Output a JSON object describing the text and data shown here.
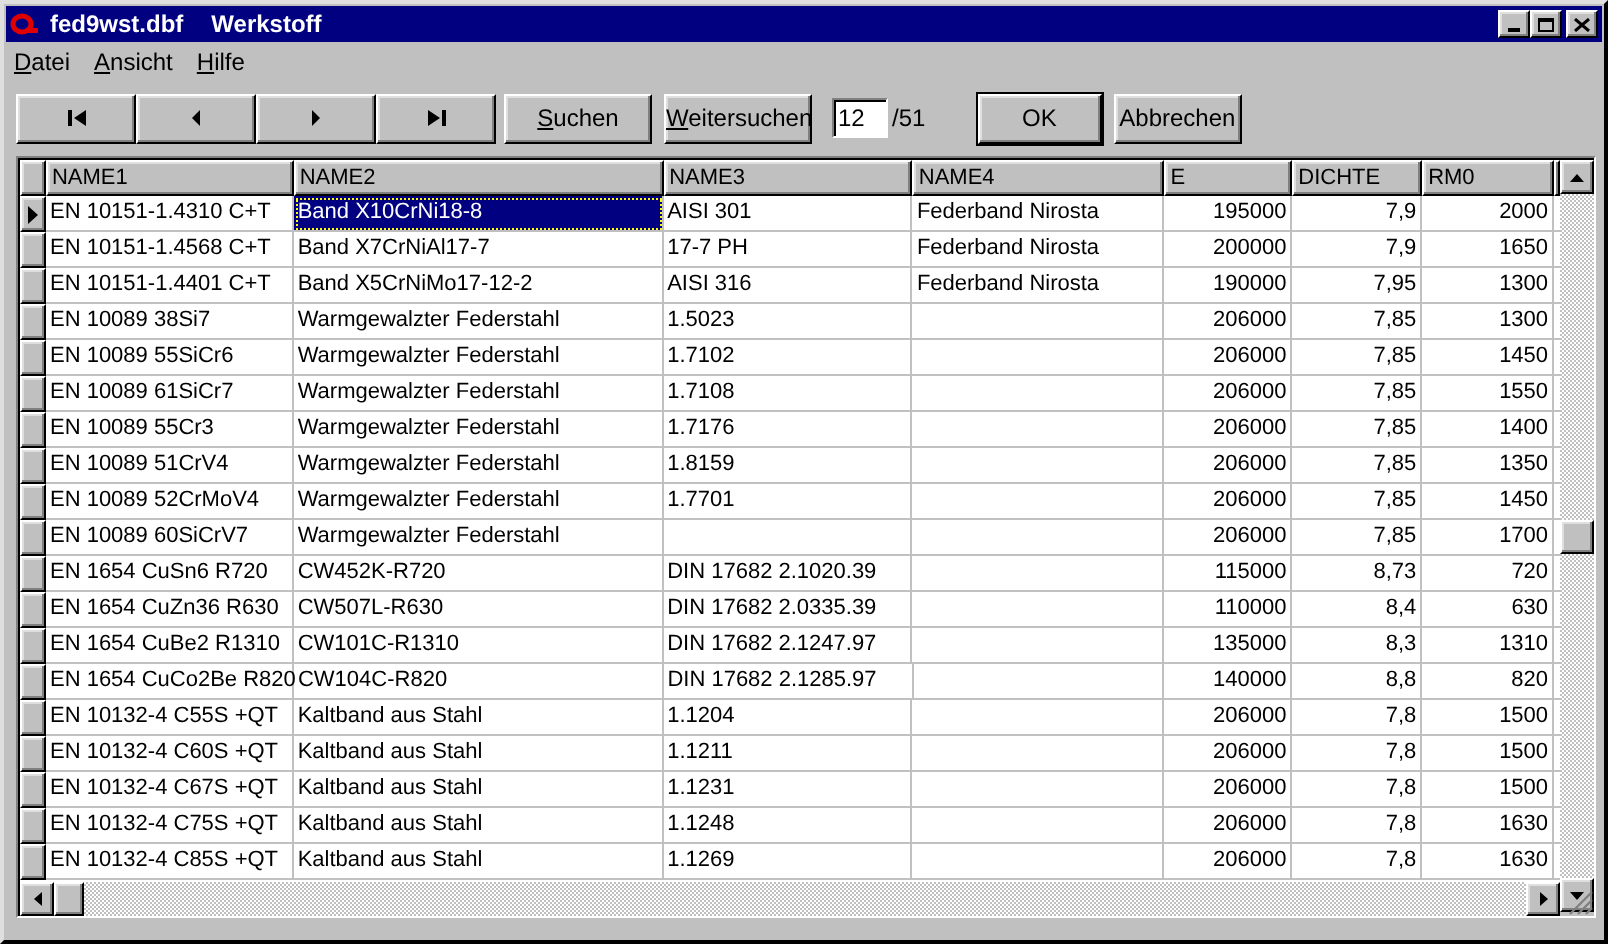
{
  "window": {
    "filename": "fed9wst.dbf",
    "title": "Werkstoff"
  },
  "menu": [
    {
      "label": "Datei",
      "mnemonic": true
    },
    {
      "label": "Ansicht",
      "mnemonic": true
    },
    {
      "label": "Hilfe",
      "mnemonic": true
    }
  ],
  "toolbar": {
    "nav": [
      {
        "kind": "first"
      },
      {
        "kind": "prev"
      },
      {
        "kind": "next"
      },
      {
        "kind": "last"
      }
    ],
    "search_buttons": [
      {
        "label": "Suchen",
        "mnemonic": true
      },
      {
        "label": "Weitersuchen",
        "mnemonic": true
      }
    ],
    "record": {
      "value": "12",
      "total": "/51"
    },
    "ok": {
      "label": "OK",
      "default": true
    },
    "cancel": {
      "label": "Abbrechen",
      "default": false
    }
  },
  "table": {
    "columns": [
      {
        "label": "NAME1",
        "kind": "text"
      },
      {
        "label": "NAME2",
        "kind": "text"
      },
      {
        "label": "NAME3",
        "kind": "text"
      },
      {
        "label": "NAME4",
        "kind": "text"
      },
      {
        "label": "E",
        "kind": "number"
      },
      {
        "label": "DICHTE",
        "kind": "number"
      },
      {
        "label": "RM0",
        "kind": "number"
      }
    ],
    "rows": [
      {
        "selected": true,
        "cells": [
          {
            "text": "EN 10151-1.4310 C+T",
            "selected": false
          },
          {
            "text": "Band X10CrNi18-8",
            "selected": true
          },
          {
            "text": "AISI 301",
            "selected": false
          },
          {
            "text": "Federband Nirosta",
            "selected": false
          },
          {
            "text": "195000",
            "selected": false
          },
          {
            "text": "7,9",
            "selected": false
          },
          {
            "text": "2000",
            "selected": false
          }
        ]
      },
      {
        "selected": false,
        "cells": [
          {
            "text": "EN 10151-1.4568 C+T",
            "selected": false
          },
          {
            "text": "Band X7CrNiAl17-7",
            "selected": false
          },
          {
            "text": "17-7 PH",
            "selected": false
          },
          {
            "text": "Federband Nirosta",
            "selected": false
          },
          {
            "text": "200000",
            "selected": false
          },
          {
            "text": "7,9",
            "selected": false
          },
          {
            "text": "1650",
            "selected": false
          }
        ]
      },
      {
        "selected": false,
        "cells": [
          {
            "text": "EN 10151-1.4401 C+T",
            "selected": false
          },
          {
            "text": "Band X5CrNiMo17-12-2",
            "selected": false
          },
          {
            "text": "AISI 316",
            "selected": false
          },
          {
            "text": "Federband Nirosta",
            "selected": false
          },
          {
            "text": "190000",
            "selected": false
          },
          {
            "text": "7,95",
            "selected": false
          },
          {
            "text": "1300",
            "selected": false
          }
        ]
      },
      {
        "selected": false,
        "cells": [
          {
            "text": "EN 10089 38Si7",
            "selected": false
          },
          {
            "text": "Warmgewalzter Federstahl",
            "selected": false
          },
          {
            "text": "1.5023",
            "selected": false
          },
          {
            "selected": false
          },
          {
            "text": "206000",
            "selected": false
          },
          {
            "text": "7,85",
            "selected": false
          },
          {
            "text": "1300",
            "selected": false
          }
        ]
      },
      {
        "selected": false,
        "cells": [
          {
            "text": "EN 10089 55SiCr6",
            "selected": false
          },
          {
            "text": "Warmgewalzter Federstahl",
            "selected": false
          },
          {
            "text": "1.7102",
            "selected": false
          },
          {
            "selected": false
          },
          {
            "text": "206000",
            "selected": false
          },
          {
            "text": "7,85",
            "selected": false
          },
          {
            "text": "1450",
            "selected": false
          }
        ]
      },
      {
        "selected": false,
        "cells": [
          {
            "text": "EN 10089 61SiCr7",
            "selected": false
          },
          {
            "text": "Warmgewalzter Federstahl",
            "selected": false
          },
          {
            "text": "1.7108",
            "selected": false
          },
          {
            "selected": false
          },
          {
            "text": "206000",
            "selected": false
          },
          {
            "text": "7,85",
            "selected": false
          },
          {
            "text": "1550",
            "selected": false
          }
        ]
      },
      {
        "selected": false,
        "cells": [
          {
            "text": "EN 10089 55Cr3",
            "selected": false
          },
          {
            "text": "Warmgewalzter Federstahl",
            "selected": false
          },
          {
            "text": "1.7176",
            "selected": false
          },
          {
            "selected": false
          },
          {
            "text": "206000",
            "selected": false
          },
          {
            "text": "7,85",
            "selected": false
          },
          {
            "text": "1400",
            "selected": false
          }
        ]
      },
      {
        "selected": false,
        "cells": [
          {
            "text": "EN 10089 51CrV4",
            "selected": false
          },
          {
            "text": "Warmgewalzter Federstahl",
            "selected": false
          },
          {
            "text": "1.8159",
            "selected": false
          },
          {
            "selected": false
          },
          {
            "text": "206000",
            "selected": false
          },
          {
            "text": "7,85",
            "selected": false
          },
          {
            "text": "1350",
            "selected": false
          }
        ]
      },
      {
        "selected": false,
        "cells": [
          {
            "text": "EN 10089 52CrMoV4",
            "selected": false
          },
          {
            "text": "Warmgewalzter Federstahl",
            "selected": false
          },
          {
            "text": "1.7701",
            "selected": false
          },
          {
            "selected": false
          },
          {
            "text": "206000",
            "selected": false
          },
          {
            "text": "7,85",
            "selected": false
          },
          {
            "text": "1450",
            "selected": false
          }
        ]
      },
      {
        "selected": false,
        "cells": [
          {
            "text": "EN 10089 60SiCrV7",
            "selected": false
          },
          {
            "text": "Warmgewalzter Federstahl",
            "selected": false
          },
          {
            "selected": false
          },
          {
            "selected": false
          },
          {
            "text": "206000",
            "selected": false
          },
          {
            "text": "7,85",
            "selected": false
          },
          {
            "text": "1700",
            "selected": false
          }
        ]
      },
      {
        "selected": false,
        "cells": [
          {
            "text": "EN 1654 CuSn6 R720",
            "selected": false
          },
          {
            "text": "CW452K-R720",
            "selected": false
          },
          {
            "text": "DIN 17682 2.1020.39",
            "selected": false
          },
          {
            "selected": false
          },
          {
            "text": "115000",
            "selected": false
          },
          {
            "text": "8,73",
            "selected": false
          },
          {
            "text": "720",
            "selected": false
          }
        ]
      },
      {
        "selected": false,
        "cells": [
          {
            "text": "EN 1654 CuZn36 R630",
            "selected": false
          },
          {
            "text": "CW507L-R630",
            "selected": false
          },
          {
            "text": "DIN 17682 2.0335.39",
            "selected": false
          },
          {
            "selected": false
          },
          {
            "text": "110000",
            "selected": false
          },
          {
            "text": "8,4",
            "selected": false
          },
          {
            "text": "630",
            "selected": false
          }
        ]
      },
      {
        "selected": false,
        "cells": [
          {
            "text": "EN 1654 CuBe2 R1310",
            "selected": false
          },
          {
            "text": "CW101C-R1310",
            "selected": false
          },
          {
            "text": "DIN 17682 2.1247.97",
            "selected": false
          },
          {
            "selected": false
          },
          {
            "text": "135000",
            "selected": false
          },
          {
            "text": "8,3",
            "selected": false
          },
          {
            "text": "1310",
            "selected": false
          }
        ]
      },
      {
        "selected": false,
        "cells": [
          {
            "text": "EN 1654 CuCo2Be R820",
            "selected": false
          },
          {
            "text": "CW104C-R820",
            "selected": false
          },
          {
            "text": "DIN 17682 2.1285.97",
            "selected": false
          },
          {
            "selected": false
          },
          {
            "text": "140000",
            "selected": false
          },
          {
            "text": "8,8",
            "selected": false
          },
          {
            "text": "820",
            "selected": false
          }
        ]
      },
      {
        "selected": false,
        "cells": [
          {
            "text": "EN 10132-4 C55S +QT",
            "selected": false
          },
          {
            "text": "Kaltband aus Stahl",
            "selected": false
          },
          {
            "text": "1.1204",
            "selected": false
          },
          {
            "selected": false
          },
          {
            "text": "206000",
            "selected": false
          },
          {
            "text": "7,8",
            "selected": false
          },
          {
            "text": "1500",
            "selected": false
          }
        ]
      },
      {
        "selected": false,
        "cells": [
          {
            "text": "EN 10132-4 C60S +QT",
            "selected": false
          },
          {
            "text": "Kaltband aus Stahl",
            "selected": false
          },
          {
            "text": "1.1211",
            "selected": false
          },
          {
            "selected": false
          },
          {
            "text": "206000",
            "selected": false
          },
          {
            "text": "7,8",
            "selected": false
          },
          {
            "text": "1500",
            "selected": false
          }
        ]
      },
      {
        "selected": false,
        "cells": [
          {
            "text": "EN 10132-4 C67S +QT",
            "selected": false
          },
          {
            "text": "Kaltband aus Stahl",
            "selected": false
          },
          {
            "text": "1.1231",
            "selected": false
          },
          {
            "selected": false
          },
          {
            "text": "206000",
            "selected": false
          },
          {
            "text": "7,8",
            "selected": false
          },
          {
            "text": "1500",
            "selected": false
          }
        ]
      },
      {
        "selected": false,
        "cells": [
          {
            "text": "EN 10132-4 C75S +QT",
            "selected": false
          },
          {
            "text": "Kaltband aus Stahl",
            "selected": false
          },
          {
            "text": "1.1248",
            "selected": false
          },
          {
            "selected": false
          },
          {
            "text": "206000",
            "selected": false
          },
          {
            "text": "7,8",
            "selected": false
          },
          {
            "text": "1630",
            "selected": false
          }
        ]
      },
      {
        "selected": false,
        "cells": [
          {
            "text": "EN 10132-4 C85S +QT",
            "selected": false
          },
          {
            "text": "Kaltband aus Stahl",
            "selected": false
          },
          {
            "text": "1.1269",
            "selected": false
          },
          {
            "selected": false
          },
          {
            "text": "206000",
            "selected": false
          },
          {
            "text": "7,8",
            "selected": false
          },
          {
            "text": "1630",
            "selected": false
          }
        ]
      }
    ]
  }
}
